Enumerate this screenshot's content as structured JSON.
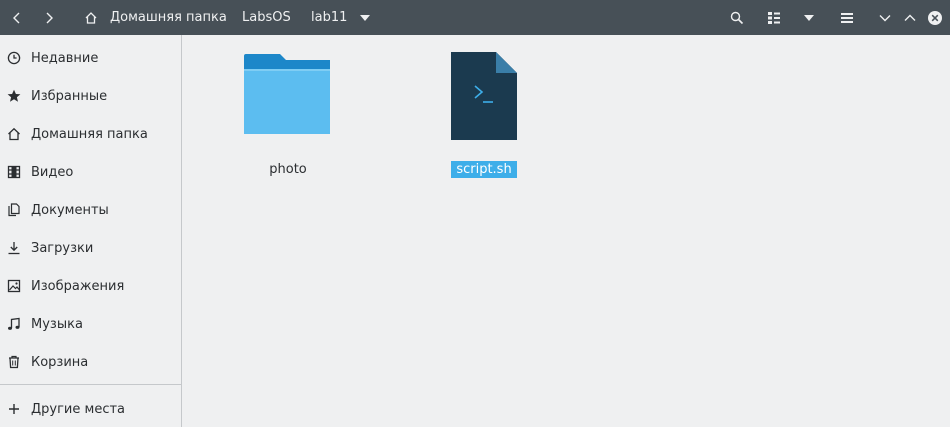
{
  "header": {
    "back_icon": "chevron-left-icon",
    "forward_icon": "chevron-right-icon",
    "home_icon": "home-icon",
    "breadcrumbs": [
      "Домашняя папка",
      "LabsOS",
      "lab11"
    ],
    "search_icon": "search-icon",
    "view_icon": "view-options-icon",
    "menu_icon": "hamburger-menu-icon",
    "window_minimize_icon": "chevron-down-icon",
    "window_maximize_icon": "chevron-up-icon",
    "window_close_icon": "close-icon",
    "colors": {
      "bar": "#475057",
      "text": "#eff0f1"
    }
  },
  "sidebar": {
    "items": [
      {
        "label": "Недавние",
        "icon": "clock-icon"
      },
      {
        "label": "Избранные",
        "icon": "star-icon"
      },
      {
        "label": "Домашняя папка",
        "icon": "home-icon"
      },
      {
        "label": "Видео",
        "icon": "film-icon"
      },
      {
        "label": "Документы",
        "icon": "document-icon"
      },
      {
        "label": "Загрузки",
        "icon": "download-icon"
      },
      {
        "label": "Изображения",
        "icon": "image-icon"
      },
      {
        "label": "Музыка",
        "icon": "music-icon"
      },
      {
        "label": "Корзина",
        "icon": "trash-icon"
      }
    ],
    "other_places": {
      "label": "Другие места",
      "icon": "plus-icon"
    }
  },
  "files": [
    {
      "name": "photo",
      "type": "folder",
      "icon": "folder-icon",
      "selected": false
    },
    {
      "name": "script.sh",
      "type": "shell-script",
      "icon": "terminal-file-icon",
      "selected": true
    }
  ],
  "colors": {
    "selection": "#3daee9",
    "folder_body": "#5cbdf0",
    "folder_tab": "#1d87c9",
    "script_body": "#1b3a4f"
  }
}
